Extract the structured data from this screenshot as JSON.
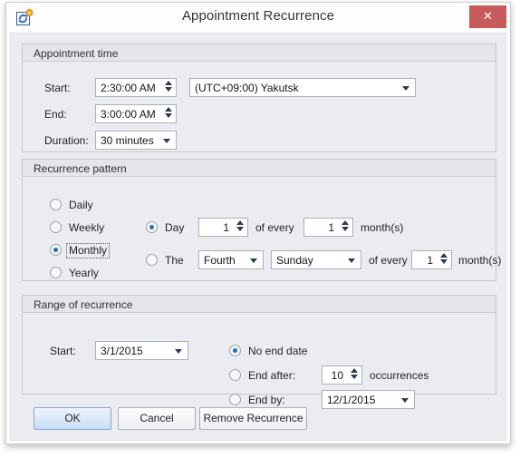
{
  "window": {
    "title": "Appointment Recurrence",
    "icon": "recurrence-icon",
    "close_label": "✕"
  },
  "appointment_time": {
    "legend": "Appointment time",
    "start_label": "Start:",
    "start_value": "2:30:00 AM",
    "end_label": "End:",
    "end_value": "3:00:00 AM",
    "duration_label": "Duration:",
    "duration_value": "30 minutes",
    "timezone_value": "(UTC+09:00) Yakutsk"
  },
  "recurrence_pattern": {
    "legend": "Recurrence pattern",
    "frequency": {
      "daily": "Daily",
      "weekly": "Weekly",
      "monthly": "Monthly",
      "yearly": "Yearly",
      "selected": "Monthly"
    },
    "day_radio_label": "Day",
    "day_number": "1",
    "day_of_every_label": "of every",
    "day_months_value": "1",
    "day_months_label": "month(s)",
    "the_radio_label": "The",
    "ordinal_value": "Fourth",
    "weekday_value": "Sunday",
    "the_of_every_label": "of every",
    "the_months_value": "1",
    "the_months_label": "month(s)",
    "selected_mode": "Day"
  },
  "range_of_recurrence": {
    "legend": "Range of recurrence",
    "start_label": "Start:",
    "start_value": "3/1/2015",
    "no_end_date_label": "No end date",
    "end_after_label": "End after:",
    "occurrences_value": "10",
    "occurrences_label": "occurrences",
    "end_by_label": "End by:",
    "end_by_value": "12/1/2015",
    "selected": "No end date"
  },
  "buttons": {
    "ok": "OK",
    "cancel": "Cancel",
    "remove": "Remove Recurrence"
  },
  "colors": {
    "accent": "#1f6fd0",
    "close": "#c75a5a",
    "dialog_bg": "#eaecef"
  }
}
